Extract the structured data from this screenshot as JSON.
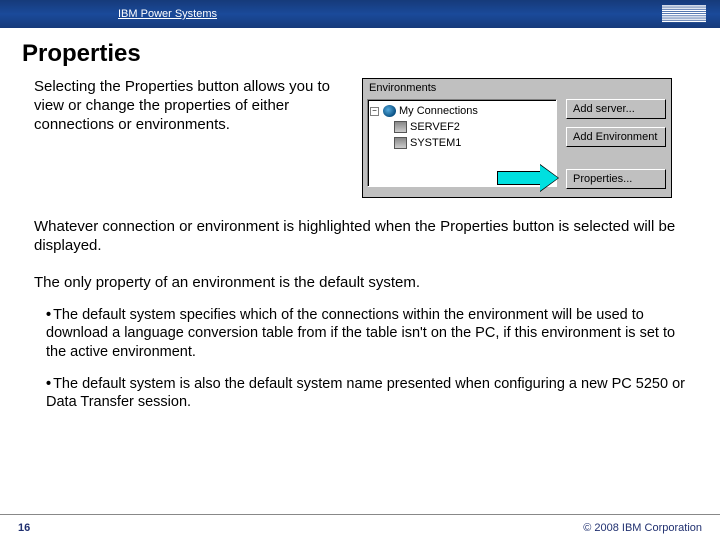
{
  "header": {
    "brand_line": "IBM Power Systems",
    "logo_alt": "IBM"
  },
  "title": "Properties",
  "paragraphs": {
    "p1": "Selecting the Properties button allows you to view or change the properties of either connections or environments.",
    "p2": "Whatever connection or environment is highlighted when the Properties button is selected will be displayed.",
    "p3": "The only property of an environment is the default system."
  },
  "bullets": [
    "The default system specifies which of the connections within the environment will be used to download a language conversion table from if the table isn't on the PC, if this environment is set to the active environment.",
    "The default system is also the default system name presented when configuring a new PC 5250 or Data Transfer session."
  ],
  "env_panel": {
    "label": "Environments",
    "tree": {
      "root": "My Connections",
      "children": [
        "SERVEF2",
        "SYSTEM1"
      ]
    },
    "buttons": {
      "add_server": "Add server...",
      "add_env": "Add Environment",
      "properties": "Properties..."
    }
  },
  "footer": {
    "page": "16",
    "copyright": "© 2008 IBM Corporation"
  }
}
